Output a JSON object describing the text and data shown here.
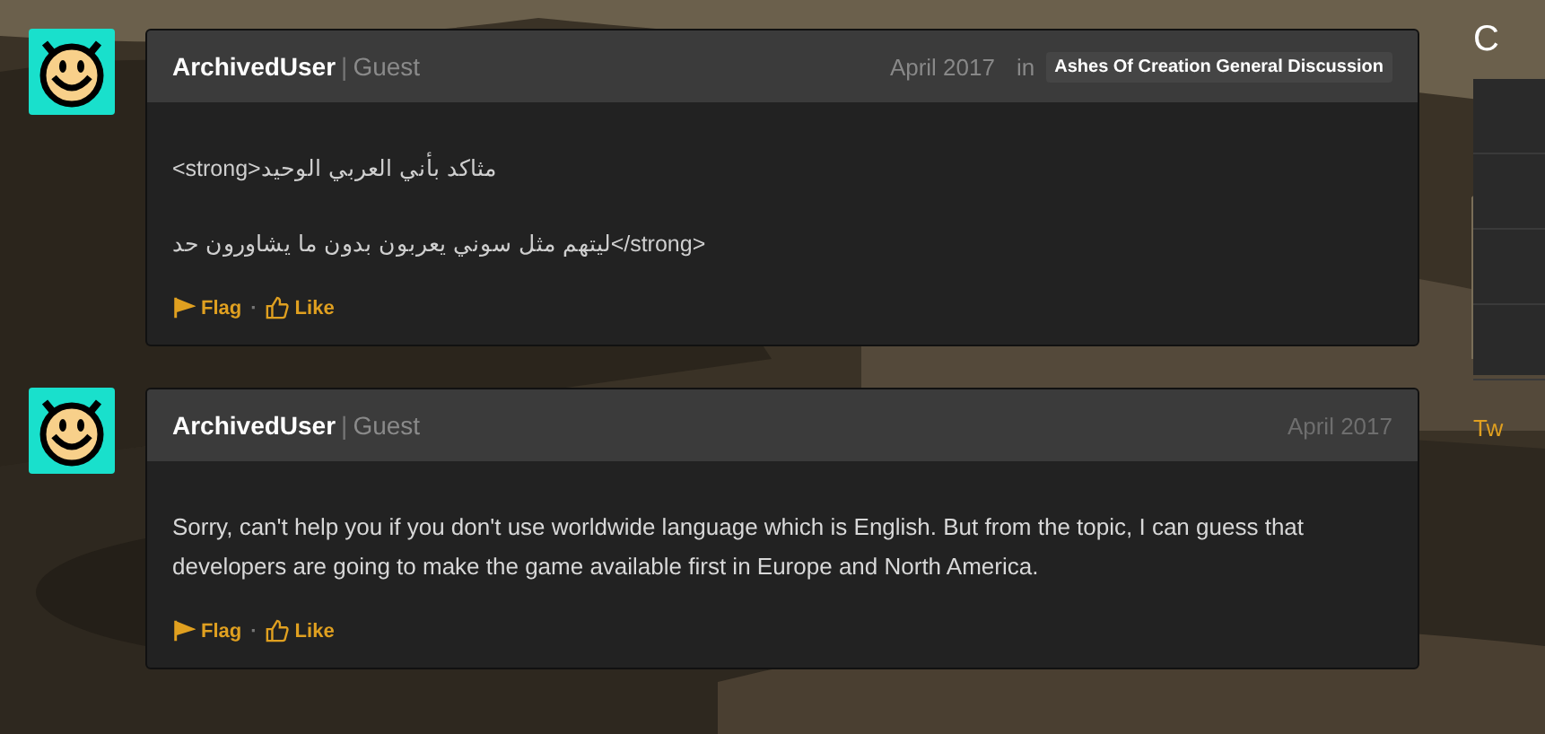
{
  "posts": [
    {
      "author": "ArchivedUser",
      "divider": "|",
      "role": "Guest",
      "date": "April 2017",
      "in_label": "in",
      "category": "Ashes Of Creation General Discussion",
      "paragraphs": [
        "<strong>مثاكد بأني العربي الوحيد",
        "ليتهم مثل سوني يعربون بدون ما يشاورون حد</strong>"
      ],
      "actions": {
        "flag": "Flag",
        "separator": "·",
        "like": "Like"
      }
    },
    {
      "author": "ArchivedUser",
      "divider": "|",
      "role": "Guest",
      "date": "April 2017",
      "paragraphs": [
        "Sorry, can't help you if you don't use worldwide language which is English. But from the topic, I can guess that developers are going to make the game available first in Europe and North America."
      ],
      "actions": {
        "flag": "Flag",
        "separator": "·",
        "like": "Like"
      }
    }
  ],
  "sidebar": {
    "heading": "C",
    "link": "Tw"
  }
}
